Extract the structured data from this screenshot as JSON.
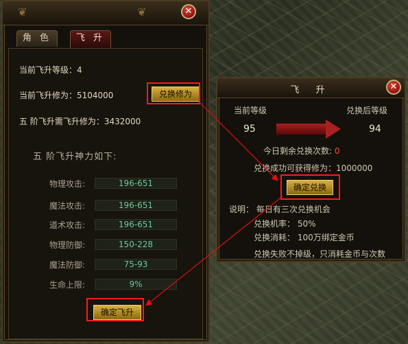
{
  "left_panel": {
    "tabs": [
      {
        "label": "角 色",
        "active": false
      },
      {
        "label": "飞 升",
        "active": true
      }
    ],
    "current_level": "当前飞升等级：4",
    "current_cultivation": "当前飞升修为：5104000",
    "exchange_button": "兑换修为",
    "next_requirement": "五 阶飞升需飞升修为：3432000",
    "section_title": "五 阶飞升神力如下:",
    "stats": [
      {
        "label": "物理攻击:",
        "value": "196-651"
      },
      {
        "label": "魔法攻击:",
        "value": "196-651"
      },
      {
        "label": "道术攻击:",
        "value": "196-651"
      },
      {
        "label": "物理防御:",
        "value": "150-228"
      },
      {
        "label": "魔法防御:",
        "value": "75-93"
      },
      {
        "label": "生命上限:",
        "value": "9%"
      }
    ],
    "confirm_button": "确定飞升"
  },
  "dialog": {
    "title": "飞 升",
    "current_level_label": "当前等级",
    "after_level_label": "兑换后等级",
    "current_level_value": "95",
    "after_level_value": "94",
    "remaining_label": "今日剩余兑换次数:",
    "remaining_value": "0",
    "gain_text": "兑换成功可获得修为：1000000",
    "confirm_button": "确定兑换",
    "note_line1": "说明：  每日有三次兑换机会",
    "note_line2": "兑换机率：  50%",
    "note_line3": "兑换消耗：  100万绑定金币",
    "note_line4": "兑换失败不掉级，只消耗金币与次数"
  },
  "colors": {
    "highlight_frame": "#ff1a1a",
    "stat_value": "#6ec89a",
    "gold_button": "#d8b040",
    "close_button": "#c02418"
  }
}
